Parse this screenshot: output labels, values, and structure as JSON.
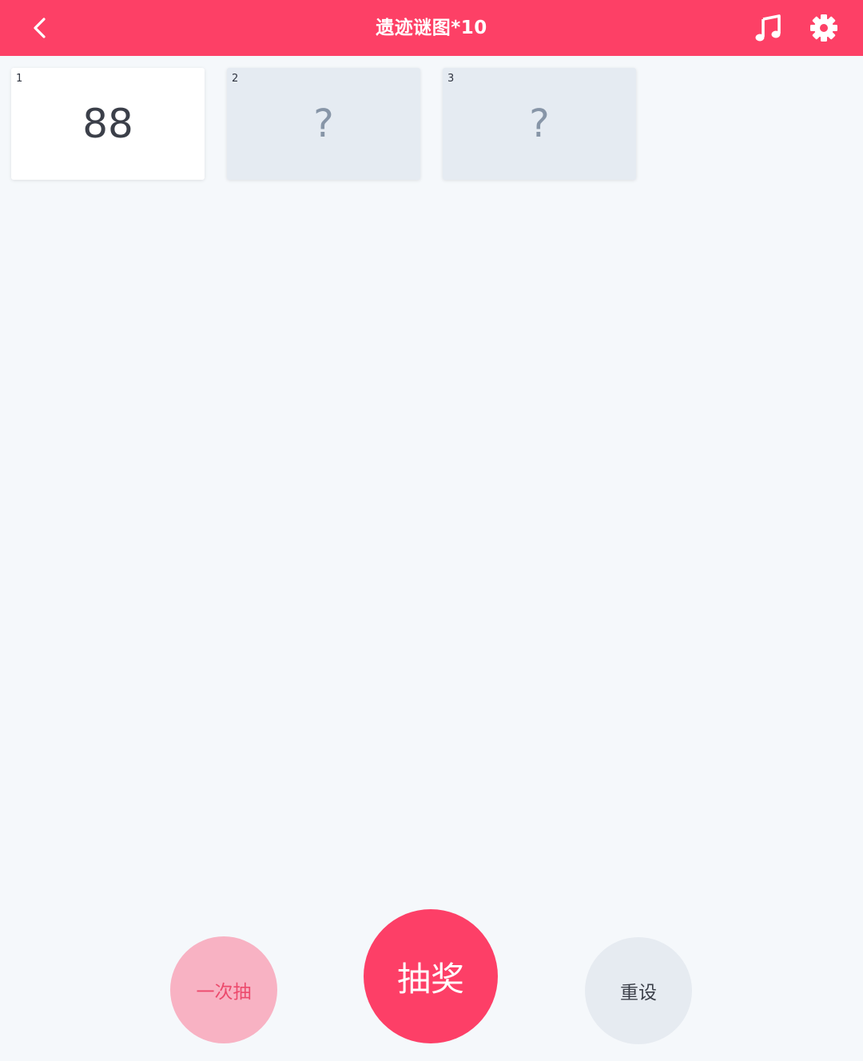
{
  "header": {
    "title": "遗迹谜图*10",
    "back_icon": "chevron-left-icon",
    "music_icon": "music-note-icon",
    "settings_icon": "gear-icon"
  },
  "cards": [
    {
      "index": "1",
      "value": "88",
      "state": "revealed"
    },
    {
      "index": "2",
      "value": "?",
      "state": "hidden"
    },
    {
      "index": "3",
      "value": "?",
      "state": "hidden"
    }
  ],
  "buttons": {
    "once_label": "一次抽",
    "draw_label": "抽奖",
    "reset_label": "重设"
  },
  "colors": {
    "accent": "#fd4066",
    "background": "#f5f8fb",
    "card_hidden": "#e5ebf2",
    "card_revealed": "#ffffff",
    "once_button": "#f8b2c3",
    "reset_button": "#e6ebf1"
  }
}
